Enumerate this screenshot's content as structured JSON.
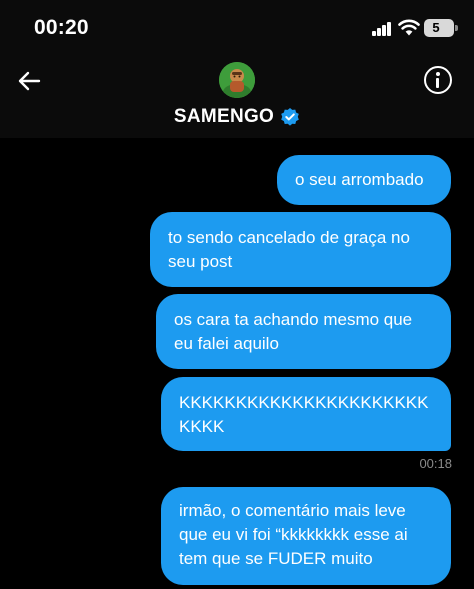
{
  "status_bar": {
    "time": "00:20",
    "battery_level": "5"
  },
  "header": {
    "username": "SAMENGO",
    "verified": true,
    "icons": {
      "back": "arrow-left-icon",
      "info": "info-icon",
      "verified": "verified-badge-icon"
    }
  },
  "messages": [
    {
      "text": "o seu arrombado",
      "sender": "self"
    },
    {
      "text": "to sendo cancelado de graça no seu post",
      "sender": "self"
    },
    {
      "text": "os cara ta achando mesmo que eu falei aquilo",
      "sender": "self"
    },
    {
      "text": "KKKKKKKKKKKKKKKKKKKKKKKKKK",
      "sender": "self",
      "time": "00:18"
    },
    {
      "text": "irmão, o comentário mais leve que eu vi foi “kkkkkkkk esse ai tem que se FUDER muito",
      "sender": "self"
    }
  ],
  "colors": {
    "bubble": "#1d9bf0",
    "background": "#000000",
    "header_bg": "#0b0b0b",
    "verified": "#1d9bf0",
    "timestamp": "#8a8a8a"
  }
}
